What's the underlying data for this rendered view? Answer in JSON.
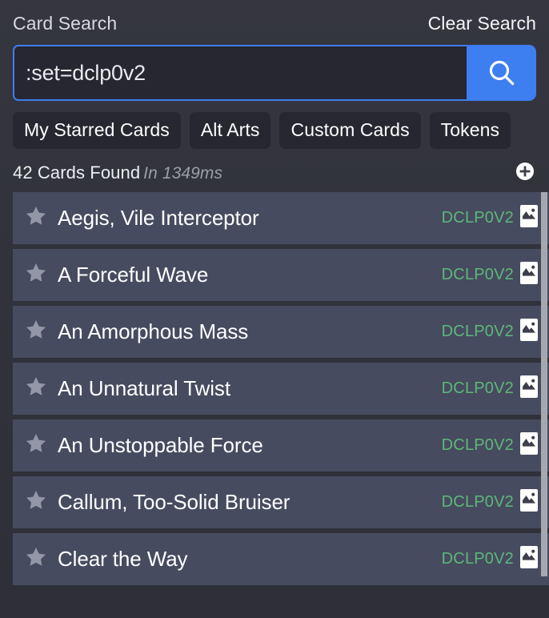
{
  "header": {
    "title": "Card Search",
    "clear_label": "Clear Search"
  },
  "search": {
    "value": ":set=dclp0v2",
    "placeholder": "Card Search",
    "button_icon": "search-icon",
    "accent_color": "#3d7ef0"
  },
  "filters": [
    {
      "label": "My Starred Cards"
    },
    {
      "label": "Alt Arts"
    },
    {
      "label": "Custom Cards"
    },
    {
      "label": "Tokens"
    }
  ],
  "results": {
    "count_label": "42 Cards Found",
    "time_label": "In 1349ms",
    "add_icon": "plus-circle-icon"
  },
  "cards": [
    {
      "name": "Aegis, Vile Interceptor",
      "set": "DCLP0V2",
      "star_icon": "star-icon",
      "image_icon": "card-image-icon"
    },
    {
      "name": "A Forceful Wave",
      "set": "DCLP0V2",
      "star_icon": "star-icon",
      "image_icon": "card-image-icon"
    },
    {
      "name": "An Amorphous Mass",
      "set": "DCLP0V2",
      "star_icon": "star-icon",
      "image_icon": "card-image-icon"
    },
    {
      "name": "An Unnatural Twist",
      "set": "DCLP0V2",
      "star_icon": "star-icon",
      "image_icon": "card-image-icon"
    },
    {
      "name": "An Unstoppable Force",
      "set": "DCLP0V2",
      "star_icon": "star-icon",
      "image_icon": "card-image-icon"
    },
    {
      "name": "Callum, Too-Solid Bruiser",
      "set": "DCLP0V2",
      "star_icon": "star-icon",
      "image_icon": "card-image-icon"
    },
    {
      "name": "Clear the Way",
      "set": "DCLP0V2",
      "star_icon": "star-icon",
      "image_icon": "card-image-icon"
    }
  ],
  "colors": {
    "accent": "#3d7ef0",
    "set_code": "#5cb87a",
    "row_background": "#474b5f",
    "page_background": "#31323b",
    "chip_background": "#262730",
    "star": "#9396a6"
  }
}
